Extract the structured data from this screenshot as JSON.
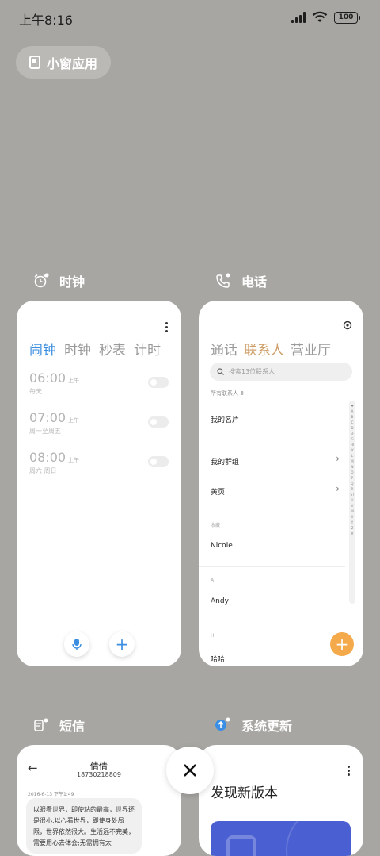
{
  "status_bar": {
    "time": "上午8:16",
    "battery": "100"
  },
  "floating_window": {
    "label": "小窗应用"
  },
  "apps": {
    "clock": {
      "name": "时钟",
      "tabs": [
        "闹钟",
        "时钟",
        "秒表",
        "计时"
      ],
      "alarms": [
        {
          "time": "06:00",
          "ampm": "上午",
          "repeat": "每天"
        },
        {
          "time": "07:00",
          "ampm": "上午",
          "repeat": "周一至周五"
        },
        {
          "time": "08:00",
          "ampm": "上午",
          "repeat": "周六 周日"
        }
      ]
    },
    "phone": {
      "name": "电话",
      "tabs": [
        "通话",
        "联系人",
        "营业厅"
      ],
      "search_placeholder": "搜索13位联系人",
      "filter_label": "所有联系人",
      "rows": {
        "my_card": "我的名片",
        "my_groups": "我的群组",
        "yellow_pages": "黄页",
        "favorites_section": "收藏",
        "nicole": "Nicole",
        "section_a": "A",
        "andy": "Andy",
        "section_h": "H",
        "haha": "哈哈"
      },
      "index_letters": "♥ABCDEFGHIJKLMNOPQRSTUVWXYZ#"
    },
    "sms": {
      "name": "短信",
      "contact_name": "倩倩",
      "contact_number": "18730218809",
      "date": "2016-6-13 下午1:49",
      "message": "以眼看世界，即使站的最高，世界还是很小;以心看世界，即使身处局限，世界依然很大。生活远不完美，需要用心去体会;无需拥有太"
    },
    "update": {
      "name": "系统更新",
      "title": "发现新版本"
    }
  },
  "colors": {
    "background": "#a7a6a2",
    "clock_accent": "#3b8de0",
    "phone_accent": "#cf9f68",
    "fab": "#f4a94b"
  }
}
